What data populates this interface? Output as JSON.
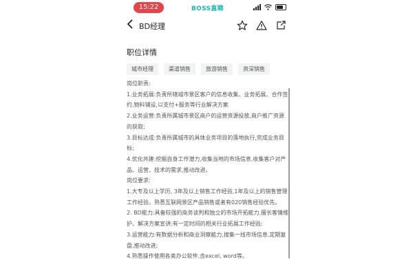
{
  "status_bar": {
    "time": "15:22",
    "brand": "BOSS直聘",
    "accent_color": "#e2454a",
    "brand_color": "#16b9ad"
  },
  "nav": {
    "back_icon": "chevron-left-icon",
    "title": "BD经理",
    "actions": [
      "star-icon",
      "warning-icon",
      "share-icon"
    ]
  },
  "section": {
    "title": "职位详情"
  },
  "tags": [
    "城市经理",
    "渠道销售",
    "旅游销售",
    "资深销售"
  ],
  "description": [
    "岗位职责:",
    "1.业务拓展:负责所辖城市景区客户的信息收集、业务拓展、合作签约,物料铺设,以支付+服务等行业解决方案",
    "2.业务运营:负责所属城市景区商户的运营资源投放,商户推广资源的获取;",
    "3.目标达成:负责所属城市的具体业务项目的落地执行,完成业务目标;",
    "4.优化共建:挖掘自身工作潜力,收集当地的市场信息,收集客户对产品、运营、技术的需求,推动改进。",
    "岗位要求:",
    "1.大专及以上学历, 3年及以上销售工作经验,1年及以上的销售管理工作经验。熟悉互联网景区产品销售或者有020销售经验优先。",
    "2. BD能力:具备较强的商务谈判和独立的市场开拓能力,擅长客情维护、解决方案宣讲;有一定时间的相关行业拓展工作经验;",
    "3.运营能力:有数据分析和商业洞察能力,搜集一线市场信息,定期复盘,推动改进;",
    "4.熟悉操作使用各类办公软件,含excel, word等。"
  ]
}
